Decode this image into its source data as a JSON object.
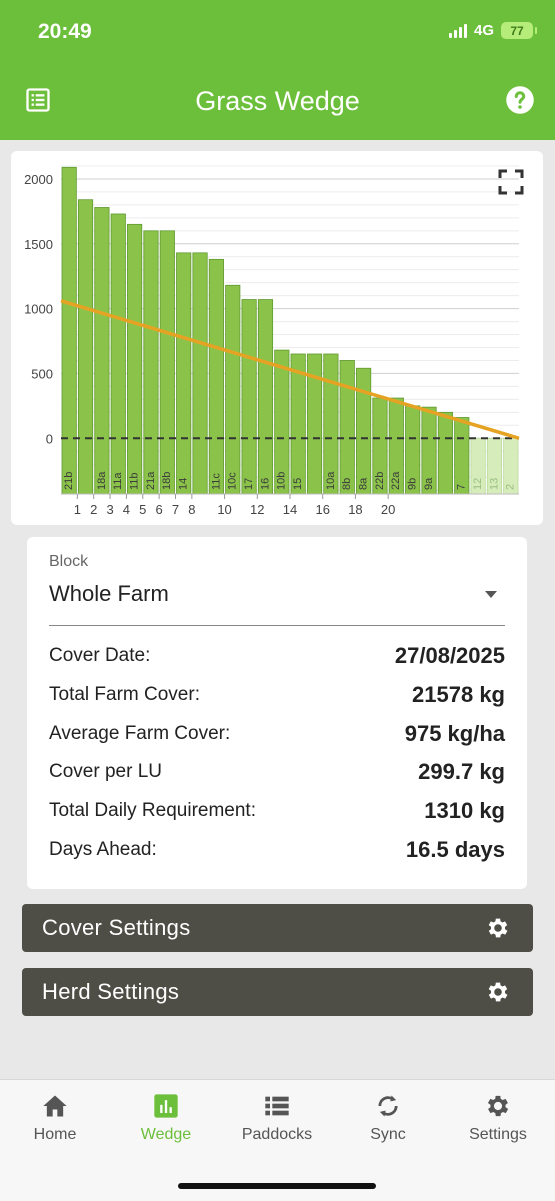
{
  "status_bar": {
    "time": "20:49",
    "network": "4G",
    "battery": "77"
  },
  "header": {
    "title": "Grass Wedge",
    "left_icon": "list-icon",
    "right_icon": "help-icon"
  },
  "chart_data": {
    "type": "bar",
    "categories": [
      "21b",
      "",
      "18a",
      "11a",
      "11b",
      "21a",
      "18b",
      "14",
      "",
      "11c",
      "10c",
      "17",
      "16",
      "10b",
      "15",
      "",
      "10a",
      "8b",
      "8a",
      "22b",
      "22a",
      "9b",
      "9a",
      "",
      "7",
      "12",
      "13",
      "2"
    ],
    "values": [
      2090,
      1840,
      1780,
      1730,
      1650,
      1600,
      1600,
      1430,
      1430,
      1380,
      1180,
      1070,
      1070,
      680,
      650,
      650,
      650,
      600,
      540,
      310,
      310,
      250,
      240,
      200,
      160,
      0,
      0,
      0
    ],
    "ylim": [
      -430,
      2100
    ],
    "yticks": [
      0,
      500,
      1000,
      1500,
      2000
    ],
    "xticks": [
      "1",
      "2",
      "3",
      "4",
      "5",
      "6",
      "7",
      "8",
      "10",
      "12",
      "14",
      "16",
      "18",
      "20"
    ],
    "target_line": {
      "start": 1060,
      "end": 0
    },
    "colors": {
      "bar": "#8bc34a",
      "bar_stroke": "#5f9a2f",
      "bar_empty": "#d6edbb",
      "target": "#e6a323",
      "baseline": "#333333"
    }
  },
  "block": {
    "label": "Block",
    "value": "Whole Farm"
  },
  "stats": [
    {
      "label": "Cover Date:",
      "value": "27/08/2025"
    },
    {
      "label": "Total Farm Cover:",
      "value": "21578 kg"
    },
    {
      "label": "Average Farm Cover:",
      "value": "975 kg/ha"
    },
    {
      "label": "Cover per LU",
      "value": "299.7 kg"
    },
    {
      "label": "Total Daily Requirement:",
      "value": "1310 kg"
    },
    {
      "label": "Days Ahead:",
      "value": "16.5 days"
    }
  ],
  "buttons": {
    "cover_settings": "Cover Settings",
    "herd_settings": "Herd Settings"
  },
  "nav": [
    {
      "label": "Home",
      "icon": "home-icon"
    },
    {
      "label": "Wedge",
      "icon": "bar-chart-icon",
      "active": true
    },
    {
      "label": "Paddocks",
      "icon": "list-icon"
    },
    {
      "label": "Sync",
      "icon": "sync-icon"
    },
    {
      "label": "Settings",
      "icon": "gear-icon"
    }
  ],
  "theme": {
    "accent": "#6cbf3a",
    "button_bg": "#4e4e46"
  }
}
